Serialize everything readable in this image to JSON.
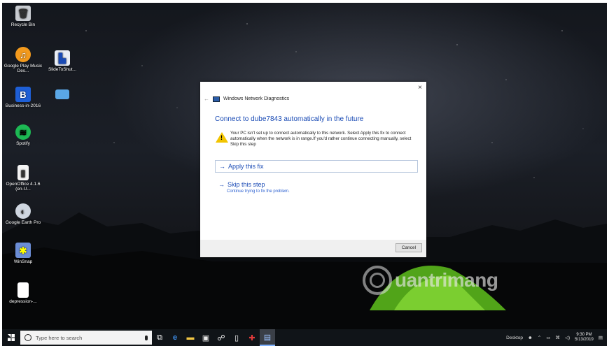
{
  "desktop": {
    "icons": [
      {
        "label": "Recycle Bin",
        "icon": "recycle-bin-icon"
      },
      {
        "label": "Google Play Music Des...",
        "icon": "google-play-music-icon"
      },
      {
        "label": "SlideToShut...",
        "icon": "slide-to-shutdown-icon"
      },
      {
        "label": "Business-in-2016",
        "icon": "business-document-icon"
      },
      {
        "label": "",
        "icon": "folder-icon"
      },
      {
        "label": "Spotify",
        "icon": "spotify-icon"
      },
      {
        "label": "OpenOffice 4.1.6 (en-U...",
        "icon": "openoffice-icon"
      },
      {
        "label": "Google Earth Pro",
        "icon": "google-earth-icon"
      },
      {
        "label": "WinSnap",
        "icon": "winsnap-icon"
      },
      {
        "label": "depression-...",
        "icon": "document-icon"
      }
    ]
  },
  "dialog": {
    "window_title": "Windows Network Diagnostics",
    "close_glyph": "×",
    "back_glyph": "←",
    "heading": "Connect to dube7843 automatically in the future",
    "message": "Your PC isn't set up to connect automatically to this network. Select Apply this fix to connect automatically when the network is in range.If you'd rather continue connecting manually, select Skip this step",
    "apply_label": "Apply this fix",
    "skip_label": "Skip this step",
    "skip_sub": "Continue trying to fix the problem.",
    "cancel_label": "Cancel",
    "arrow": "→"
  },
  "watermark": {
    "text": "uantrimang"
  },
  "taskbar": {
    "search_placeholder": "Type here to search",
    "desktop_label": "Desktop",
    "time": "9:30 PM",
    "date": "5/13/2019",
    "pinned": [
      "task-view-icon",
      "edge-icon",
      "file-explorer-icon",
      "store-icon",
      "people-icon",
      "phone-icon",
      "app-icon",
      "network-diagnostics-icon"
    ]
  }
}
